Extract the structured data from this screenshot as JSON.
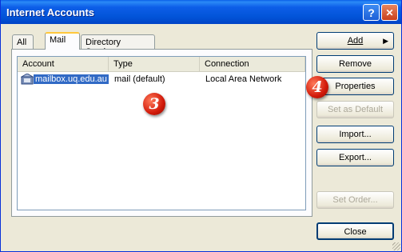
{
  "window": {
    "title": "Internet Accounts",
    "help_glyph": "?",
    "close_glyph": "✕"
  },
  "tabs": [
    {
      "label": "All"
    },
    {
      "label": "Mail"
    },
    {
      "label": "Directory Service"
    }
  ],
  "columns": [
    "Account",
    "Type",
    "Connection"
  ],
  "rows": [
    {
      "account": "mailbox.uq.edu.au",
      "type": "mail (default)",
      "connection": "Local Area Network"
    }
  ],
  "buttons": {
    "add": "Add",
    "add_arrow": "▶",
    "remove": "Remove",
    "properties": "Properties",
    "set_default": "Set as Default",
    "import": "Import...",
    "export": "Export...",
    "set_order": "Set Order...",
    "close": "Close"
  },
  "annotations": {
    "step3": "3",
    "step4": "4"
  },
  "colors": {
    "selection": "#316ac5",
    "badge": "#d21a0a",
    "titlebar": "#0254d8"
  }
}
